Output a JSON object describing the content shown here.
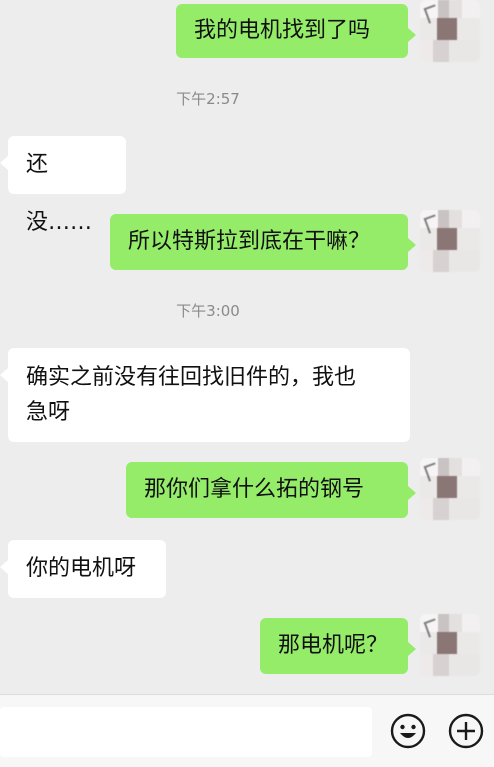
{
  "messages": [
    {
      "type": "out",
      "text": "我的电机找到了吗"
    },
    {
      "type": "time",
      "text": "下午2:57"
    },
    {
      "type": "in",
      "text": "还没……"
    },
    {
      "type": "out",
      "text": "所以特斯拉到底在干嘛？"
    },
    {
      "type": "time",
      "text": "下午3:00"
    },
    {
      "type": "in",
      "line1": "确实之前没有往回找旧件的，我也",
      "line2": "急呀"
    },
    {
      "type": "out",
      "text": "那你们拿什么拓的钢号"
    },
    {
      "type": "in",
      "text": "你的电机呀"
    },
    {
      "type": "out",
      "text": "那电机呢？"
    }
  ],
  "icons": {
    "emoji": "emoji-icon",
    "add": "add-icon"
  },
  "colors": {
    "outgoing_bubble": "#95ec69",
    "incoming_bubble": "#ffffff",
    "background": "#ededed",
    "timestamp": "#8a8a8a"
  }
}
